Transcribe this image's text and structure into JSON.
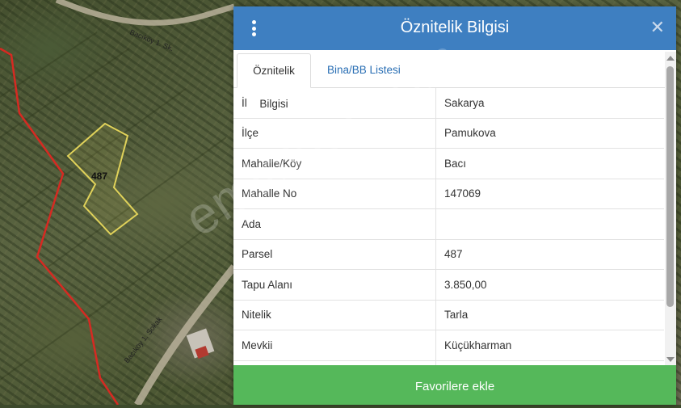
{
  "map": {
    "road_label_top": "Bacıköy 1. Sk.",
    "road_label_bottom": "Bacıköy 1. Sokak",
    "parcel_label": "487",
    "watermark": "emlakjet.com"
  },
  "panel": {
    "title": "Öznitelik Bilgisi",
    "menu_icon": "vertical-dots-icon",
    "close_label": "✕",
    "header_color": "#3e7fc1",
    "tabs": [
      {
        "label": "Öznitelik Bilgisi",
        "active": true
      },
      {
        "label": "Bina/BB Listesi",
        "active": false
      }
    ],
    "rows": [
      {
        "key": "İl",
        "value": "Sakarya"
      },
      {
        "key": "İlçe",
        "value": "Pamukova"
      },
      {
        "key": "Mahalle/Köy",
        "value": "Bacı"
      },
      {
        "key": "Mahalle No",
        "value": "147069"
      },
      {
        "key": "Ada",
        "value": ""
      },
      {
        "key": "Parsel",
        "value": "487"
      },
      {
        "key": "Tapu Alanı",
        "value": "3.850,00"
      },
      {
        "key": "Nitelik",
        "value": "Tarla"
      },
      {
        "key": "Mevkii",
        "value": "Küçükharman"
      }
    ],
    "favorite_button": "Favorilere ekle",
    "favorite_color": "#55b85a"
  }
}
